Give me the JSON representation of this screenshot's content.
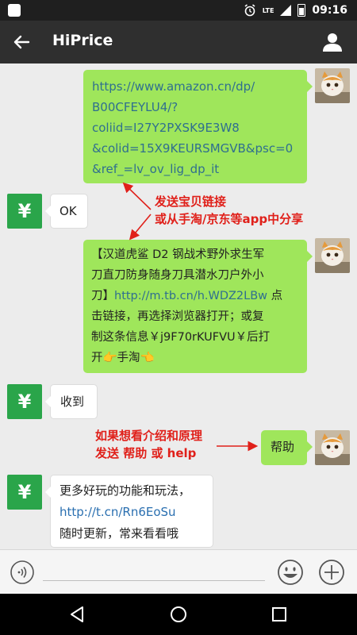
{
  "status_bar": {
    "network": "LTE",
    "time": "09:16",
    "icons": [
      "alarm-icon",
      "signal-icon",
      "battery-icon"
    ]
  },
  "app_bar": {
    "title": "HiPrice",
    "back_icon": "arrow-left-icon",
    "profile_icon": "person-icon"
  },
  "messages": [
    {
      "side": "out",
      "link_text": "https://www.amazon.cn/dp/B00CFEYLU4/?coliid=I27Y2PXSK9E3W8&colid=15X9KEURSMGVB&psc=0&ref_=lv_ov_lig_dp_it",
      "lines": [
        "https://www.amazon.cn/dp/",
        "B00CFEYLU4/?",
        "coliid=I27Y2PXSK9E3W8",
        "&colid=15X9KEURSMGVB&psc=0",
        "&ref_=lv_ov_lig_dp_it"
      ]
    },
    {
      "side": "in",
      "text": "OK",
      "avatar": "¥"
    },
    {
      "side": "out",
      "part1_line1": "【汉道虎鲨 D2 钢战术野外求生军",
      "part1_line2": "刀直刀防身随身刀具潜水刀户外小",
      "part1_line3_a": "刀】",
      "link": "http://m.tb.cn/h.WDZ2LBw",
      "part1_line3_b": " 点",
      "line4": "击链接，再选择浏览器打开；或复",
      "line5": "制这条信息￥j9F70rKUFVU￥后打",
      "line6": "开👉手淘👈"
    },
    {
      "side": "in",
      "text": "收到",
      "avatar": "¥"
    },
    {
      "side": "out",
      "text": "帮助"
    },
    {
      "side": "in",
      "avatar": "¥",
      "line1": "更多好玩的功能和玩法，",
      "link": "http://t.cn/Rn6EoSu",
      "line3": "随时更新，常来看看哦"
    }
  ],
  "annotations": {
    "a1_line1": "发送宝贝链接",
    "a1_line2": "或从手淘/京东等app中分享",
    "a2_line1": "如果想看介绍和原理",
    "a2_line2": "发送 帮助 或 help"
  },
  "input_bar": {
    "voice_icon": "voice-icon",
    "emoji_icon": "emoji-icon",
    "plus_icon": "plus-icon",
    "placeholder": ""
  },
  "nav_bar": {
    "icons": [
      "nav-back-icon",
      "nav-home-icon",
      "nav-recent-icon"
    ]
  },
  "colors": {
    "outgoing_bubble": "#9fe65b",
    "bot_avatar": "#2aa54a",
    "annotation": "#e0201a",
    "link": "#2f6f8f",
    "app_bar": "#2f2f2f"
  }
}
